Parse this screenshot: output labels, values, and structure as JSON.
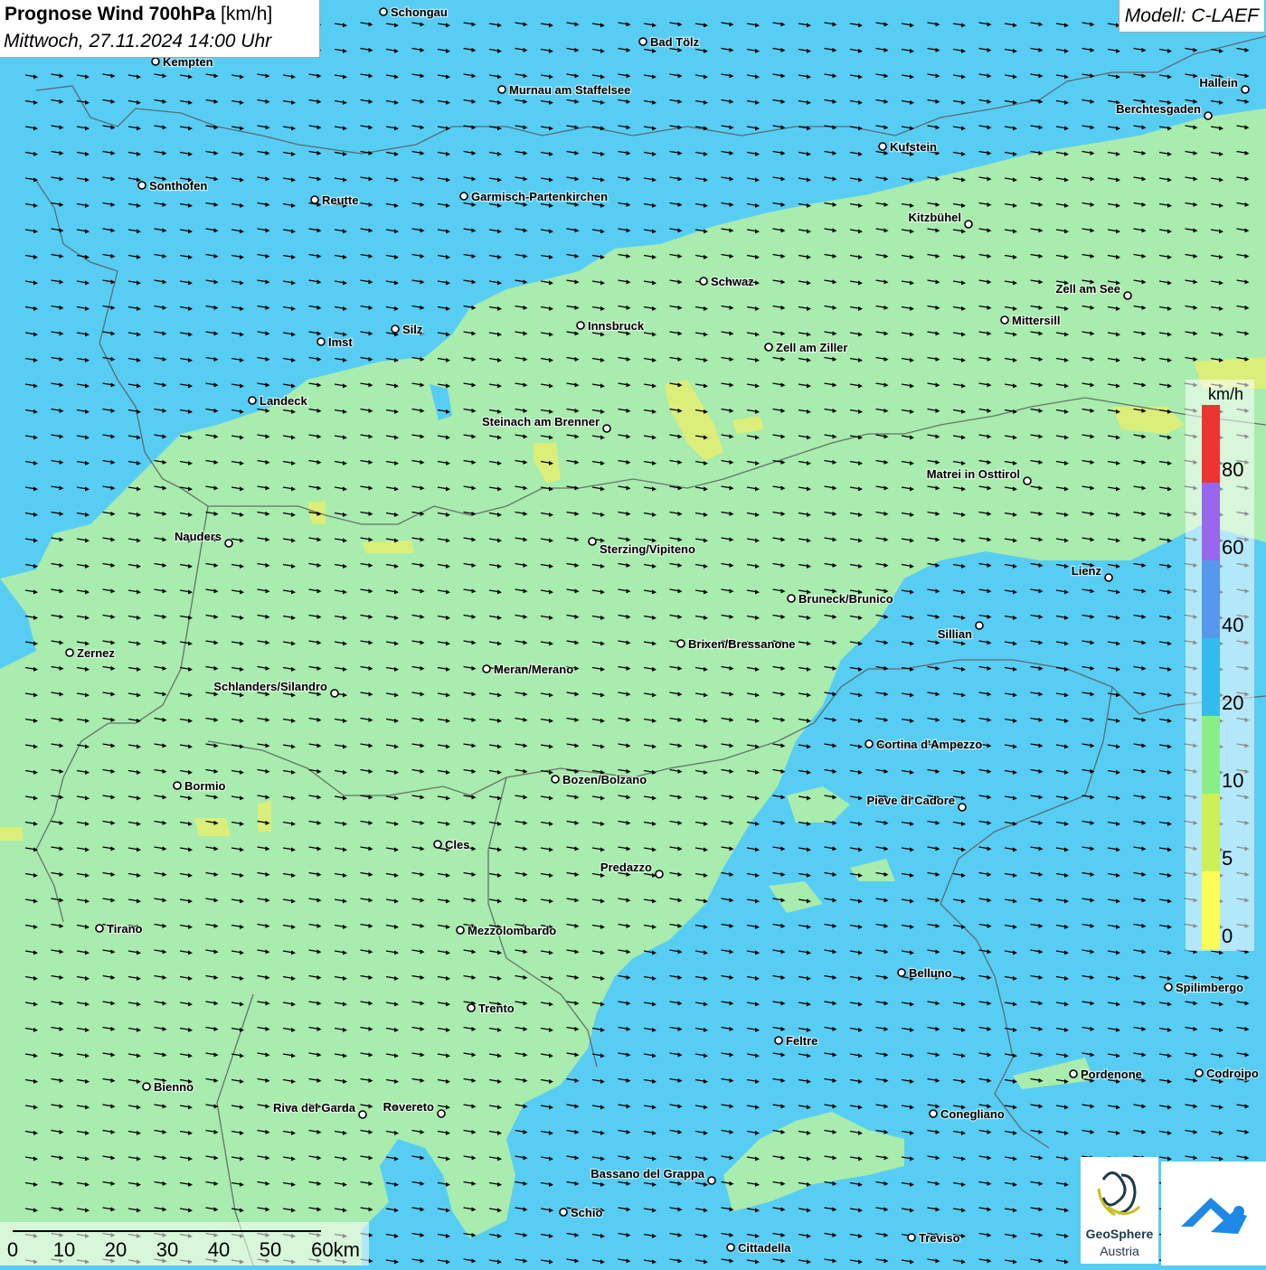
{
  "title": {
    "main": "Prognose Wind 700hPa",
    "unit": "[km/h]",
    "date": "Mittwoch, 27.11.2024 14:00 Uhr"
  },
  "model": "Modell: C-LAEF",
  "legend": {
    "unit": "km/h",
    "labels": [
      "80",
      "60",
      "40",
      "20",
      "10",
      "5",
      "0"
    ],
    "colors": [
      "#ee3333",
      "#9966ee",
      "#5599ee",
      "#33bbee",
      "#88ee88",
      "#ccf055",
      "#ffff55"
    ]
  },
  "scale_bar": {
    "labels": [
      "0",
      "10",
      "20",
      "30",
      "40",
      "50",
      "60km"
    ]
  },
  "logo": {
    "name": "GeoSphere",
    "sub": "Austria"
  },
  "colors": {
    "water_blue": "#58cdf3",
    "wind_green": "#a8ecae",
    "wind_yellow": "#dcee7a",
    "arrow": "#000000"
  },
  "wind_direction": "from west, arrows pointing east",
  "cities": [
    {
      "name": "Schongau"
    },
    {
      "name": "Bad Tölz"
    },
    {
      "name": "Kempten"
    },
    {
      "name": "Murnau am Staffelsee"
    },
    {
      "name": "Hallein"
    },
    {
      "name": "Berchtesgaden"
    },
    {
      "name": "Kufstein"
    },
    {
      "name": "Sonthofen"
    },
    {
      "name": "Reutte"
    },
    {
      "name": "Garmisch-Partenkirchen"
    },
    {
      "name": "Kitzbühel"
    },
    {
      "name": "Schwaz"
    },
    {
      "name": "Zell am See"
    },
    {
      "name": "Mittersill"
    },
    {
      "name": "Innsbruck"
    },
    {
      "name": "Imst"
    },
    {
      "name": "Silz"
    },
    {
      "name": "Zell am Ziller"
    },
    {
      "name": "Landeck"
    },
    {
      "name": "Steinach am Brenner"
    },
    {
      "name": "Matrei in Osttirol"
    },
    {
      "name": "Nauders"
    },
    {
      "name": "Sterzing/Vipiteno"
    },
    {
      "name": "Lienz"
    },
    {
      "name": "Bruneck/Brunico"
    },
    {
      "name": "Sillian"
    },
    {
      "name": "Zernez"
    },
    {
      "name": "Brixen/Bressanone"
    },
    {
      "name": "Meran/Merano"
    },
    {
      "name": "Schlanders/Silandro"
    },
    {
      "name": "Cortina d'Ampezzo"
    },
    {
      "name": "Bormio"
    },
    {
      "name": "Bozen/Bolzano"
    },
    {
      "name": "Pieve di Cadore"
    },
    {
      "name": "Cles"
    },
    {
      "name": "Predazzo"
    },
    {
      "name": "Tirano"
    },
    {
      "name": "Mezzolombardo"
    },
    {
      "name": "Belluno"
    },
    {
      "name": "Spilimbergo"
    },
    {
      "name": "Trento"
    },
    {
      "name": "Feltre"
    },
    {
      "name": "Pordenone"
    },
    {
      "name": "Codroipo"
    },
    {
      "name": "Bienno"
    },
    {
      "name": "Riva del Garda"
    },
    {
      "name": "Rovereto"
    },
    {
      "name": "Conegliano"
    },
    {
      "name": "Bassano del Grappa"
    },
    {
      "name": "Schio"
    },
    {
      "name": "Treviso"
    },
    {
      "name": "Cittadella"
    }
  ]
}
